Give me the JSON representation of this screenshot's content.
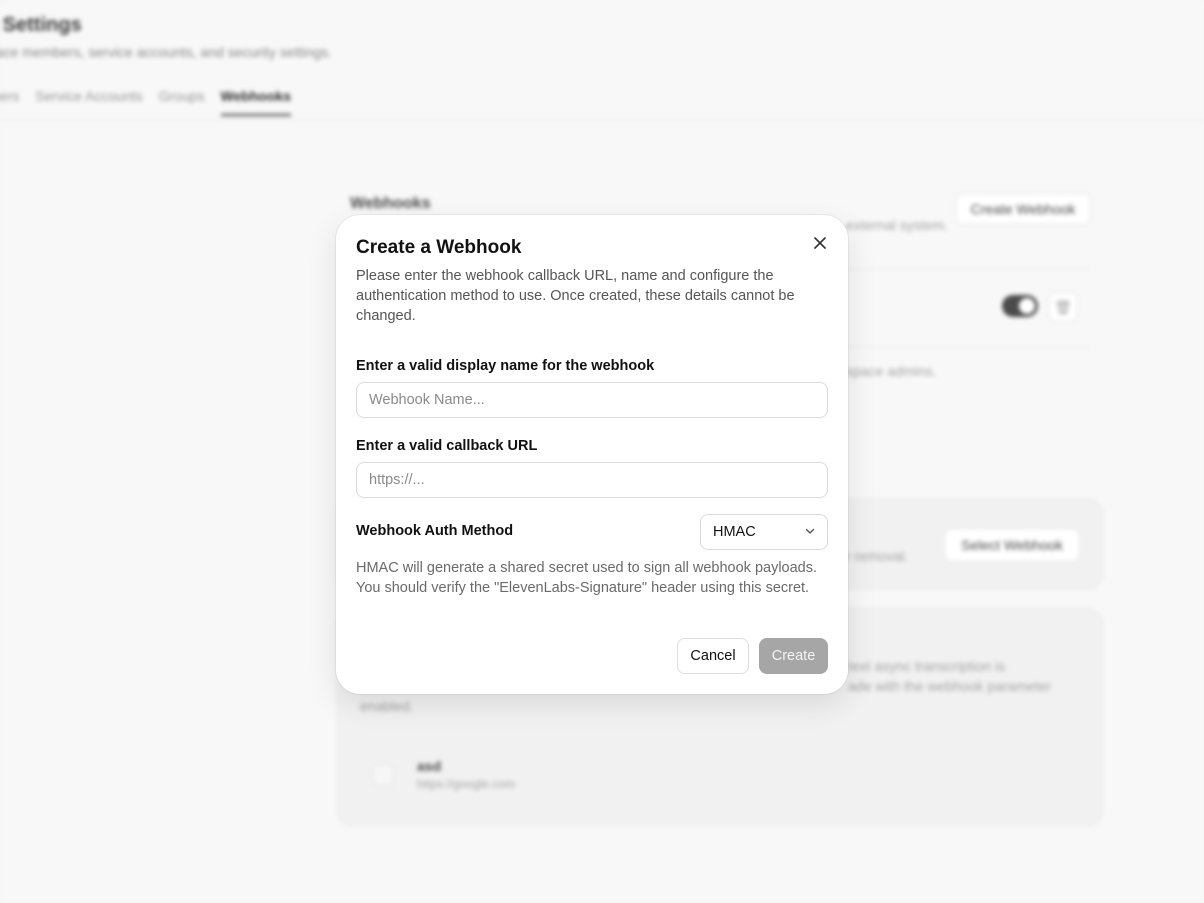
{
  "background": {
    "page_title": "e Settings",
    "page_subtitle": "pace members, service accounts, and security settings.",
    "tabs": [
      {
        "label": "bers"
      },
      {
        "label": "Service Accounts"
      },
      {
        "label": "Groups"
      },
      {
        "label": "Webhooks"
      }
    ],
    "section_title": "Webhooks",
    "section_desc": "external system.",
    "create_button": "Create Webhook",
    "admins_text": "space admins.",
    "removal_text": "r removal.",
    "select_button": "Select Webhook",
    "panel_text_1": "text async transcription is",
    "panel_text_2": "ade with the webhook parameter",
    "panel_text_3": "enabled.",
    "item_name": "asd",
    "item_url": "https://google.com"
  },
  "modal": {
    "title": "Create a Webhook",
    "description": "Please enter the webhook callback URL, name and configure the authentication method to use. Once created, these details cannot be changed.",
    "name_label": "Enter a valid display name for the webhook",
    "name_placeholder": "Webhook Name...",
    "url_label": "Enter a valid callback URL",
    "url_placeholder": "https://...",
    "auth_label": "Webhook Auth Method",
    "auth_value": "HMAC",
    "help_text": "HMAC will generate a shared secret used to sign all webhook payloads. You should verify the \"ElevenLabs-Signature\" header using this secret.",
    "cancel_label": "Cancel",
    "create_label": "Create",
    "close_icon": "close-icon"
  },
  "colors": {
    "create_disabled": "#a6a6a6",
    "toggle_on": "#333333"
  }
}
